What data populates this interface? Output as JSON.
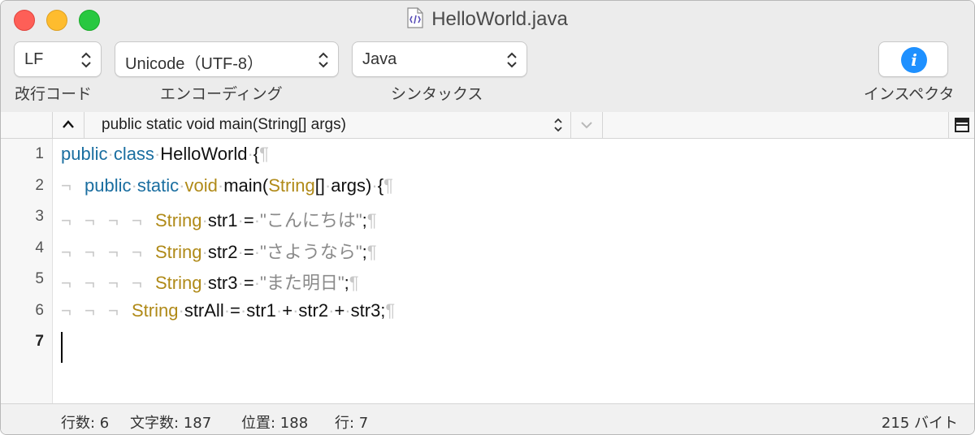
{
  "window": {
    "title": "HelloWorld.java"
  },
  "toolbar": {
    "line_ending": {
      "value": "LF",
      "label": "改行コード"
    },
    "encoding": {
      "value": "Unicode（UTF-8）",
      "label": "エンコーディング"
    },
    "syntax": {
      "value": "Java",
      "label": "シンタックス"
    },
    "inspector": {
      "label": "インスペクタ",
      "icon": "info-icon"
    }
  },
  "navbar": {
    "outline_selection": "public static void main(String[] args)"
  },
  "editor": {
    "line_numbers": [
      "1",
      "2",
      "3",
      "4",
      "5",
      "6",
      "7"
    ],
    "current_line": "7",
    "invisibles": {
      "space": "·",
      "tab": "¬",
      "newline": "¶"
    },
    "lines": [
      {
        "indent": 0,
        "tokens": [
          {
            "t": "kw",
            "v": "public"
          },
          {
            "t": "sp",
            "v": "·"
          },
          {
            "t": "kw",
            "v": "class"
          },
          {
            "t": "sp",
            "v": "·"
          },
          {
            "t": "pl",
            "v": "HelloWorld"
          },
          {
            "t": "sp",
            "v": "·"
          },
          {
            "t": "pl",
            "v": "{"
          },
          {
            "t": "nl",
            "v": "¶"
          }
        ]
      },
      {
        "indent": 1,
        "tokens": [
          {
            "t": "kw",
            "v": "public"
          },
          {
            "t": "sp",
            "v": "·"
          },
          {
            "t": "kw",
            "v": "static"
          },
          {
            "t": "sp",
            "v": "·"
          },
          {
            "t": "ty",
            "v": "void"
          },
          {
            "t": "sp",
            "v": "·"
          },
          {
            "t": "pl",
            "v": "main("
          },
          {
            "t": "ty",
            "v": "String"
          },
          {
            "t": "pl",
            "v": "[]"
          },
          {
            "t": "sp",
            "v": "·"
          },
          {
            "t": "pl",
            "v": "args)"
          },
          {
            "t": "sp",
            "v": "·"
          },
          {
            "t": "pl",
            "v": "{"
          },
          {
            "t": "nl",
            "v": "¶"
          }
        ]
      },
      {
        "indent": 4,
        "tokens": [
          {
            "t": "ty",
            "v": "String"
          },
          {
            "t": "sp",
            "v": "·"
          },
          {
            "t": "pl",
            "v": "str1"
          },
          {
            "t": "sp",
            "v": "·"
          },
          {
            "t": "pl",
            "v": "="
          },
          {
            "t": "sp",
            "v": "·"
          },
          {
            "t": "str",
            "v": "\"こんにちは\""
          },
          {
            "t": "pl",
            "v": ";"
          },
          {
            "t": "nl",
            "v": "¶"
          }
        ]
      },
      {
        "indent": 4,
        "tokens": [
          {
            "t": "ty",
            "v": "String"
          },
          {
            "t": "sp",
            "v": "·"
          },
          {
            "t": "pl",
            "v": "str2"
          },
          {
            "t": "sp",
            "v": "·"
          },
          {
            "t": "pl",
            "v": "="
          },
          {
            "t": "sp",
            "v": "·"
          },
          {
            "t": "str",
            "v": "\"さようなら\""
          },
          {
            "t": "pl",
            "v": ";"
          },
          {
            "t": "nl",
            "v": "¶"
          }
        ]
      },
      {
        "indent": 4,
        "tokens": [
          {
            "t": "ty",
            "v": "String"
          },
          {
            "t": "sp",
            "v": "·"
          },
          {
            "t": "pl",
            "v": "str3"
          },
          {
            "t": "sp",
            "v": "·"
          },
          {
            "t": "pl",
            "v": "="
          },
          {
            "t": "sp",
            "v": "·"
          },
          {
            "t": "str",
            "v": "\"また明日\""
          },
          {
            "t": "pl",
            "v": ";"
          },
          {
            "t": "nl",
            "v": "¶"
          }
        ]
      },
      {
        "indent": 3,
        "tokens": [
          {
            "t": "ty",
            "v": "String"
          },
          {
            "t": "sp",
            "v": "·"
          },
          {
            "t": "pl",
            "v": "strAll"
          },
          {
            "t": "sp",
            "v": "·"
          },
          {
            "t": "pl",
            "v": "="
          },
          {
            "t": "sp",
            "v": "·"
          },
          {
            "t": "pl",
            "v": "str1"
          },
          {
            "t": "sp",
            "v": "·"
          },
          {
            "t": "pl",
            "v": "+"
          },
          {
            "t": "sp",
            "v": "·"
          },
          {
            "t": "pl",
            "v": "str2"
          },
          {
            "t": "sp",
            "v": "·"
          },
          {
            "t": "pl",
            "v": "+"
          },
          {
            "t": "sp",
            "v": "·"
          },
          {
            "t": "pl",
            "v": "str3;"
          },
          {
            "t": "nl",
            "v": "¶"
          }
        ]
      },
      {
        "indent": 0,
        "tokens": []
      }
    ]
  },
  "status": {
    "lines": "行数: 6",
    "chars": "文字数: 187",
    "position": "位置: 188",
    "row": "行: 7",
    "size": "215 バイト"
  },
  "colors": {
    "keyword": "#1a6ea0",
    "type": "#b08a18",
    "string": "#8a8a8a",
    "invisible": "#c8c8c8",
    "info_icon": "#1e90ff"
  }
}
